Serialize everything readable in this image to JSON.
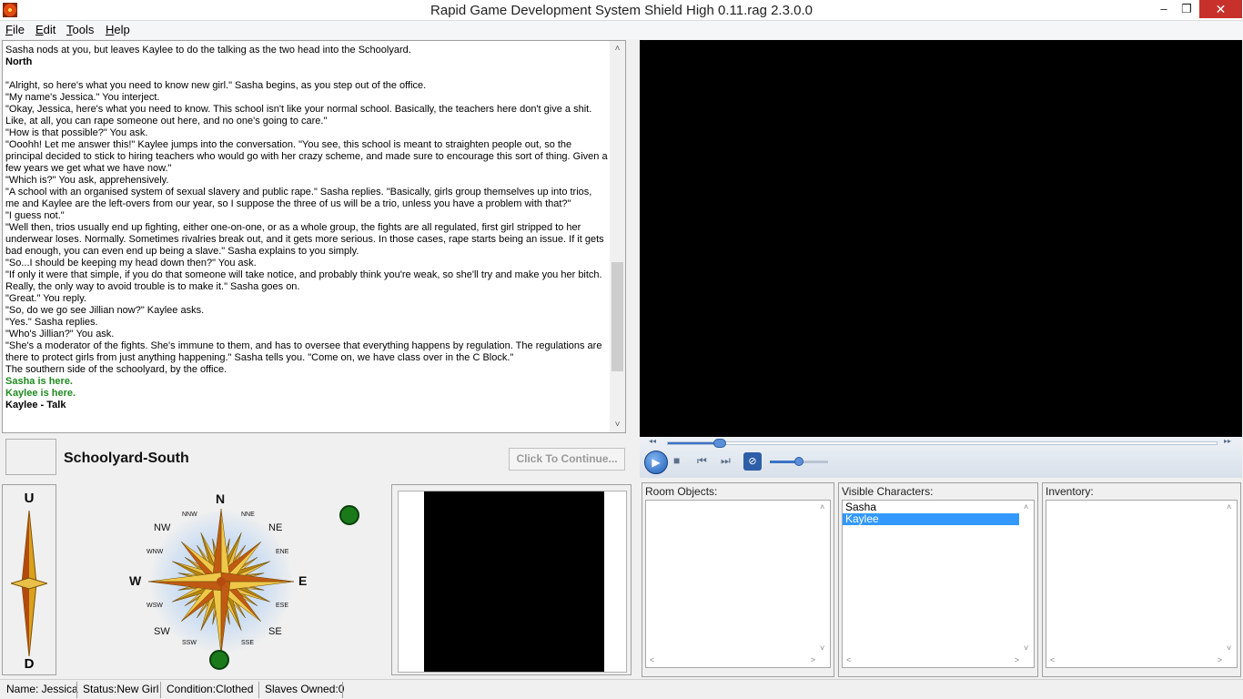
{
  "window": {
    "title": "Rapid Game Development System Shield High 0.11.rag 2.3.0.0",
    "min_glyph": "–",
    "max_glyph": "❐",
    "close_glyph": "✕"
  },
  "menu": [
    {
      "label": "File",
      "ul": "F",
      "rest": "ile"
    },
    {
      "label": "Edit",
      "ul": "E",
      "rest": "dit"
    },
    {
      "label": "Tools",
      "ul": "T",
      "rest": "ools"
    },
    {
      "label": "Help",
      "ul": "H",
      "rest": "elp"
    }
  ],
  "story": {
    "lines": [
      {
        "style": "normal",
        "text": "Sasha nods at you, but leaves Kaylee to do the talking as the two head into the Schoolyard."
      },
      {
        "style": "bold",
        "text": "North"
      },
      {
        "style": "normal",
        "text": " "
      },
      {
        "style": "normal",
        "text": "\"Alright, so here's what you need to know new girl.\" Sasha begins, as you step out of the office."
      },
      {
        "style": "normal",
        "text": "\"My name's Jessica.\" You interject."
      },
      {
        "style": "normal",
        "text": "\"Okay, Jessica, here's what you need to know. This school isn't like your normal school. Basically, the teachers here don't give a shit. Like, at all, you can rape someone out here, and no one's going to care.\""
      },
      {
        "style": "normal",
        "text": "\"How is that possible?\" You ask."
      },
      {
        "style": "normal",
        "text": "\"Ooohh! Let me answer this!\" Kaylee jumps into the conversation. \"You see, this school is meant to straighten people out, so the principal decided to stick to hiring teachers who would go with her crazy scheme, and made sure to encourage this sort of thing. Given a few years we get what we have now.\""
      },
      {
        "style": "normal",
        "text": "\"Which is?\" You ask, apprehensively."
      },
      {
        "style": "normal",
        "text": "\"A school with an organised system of sexual slavery and public rape.\" Sasha replies. \"Basically, girls group themselves up into trios, me and Kaylee are the left-overs from our year, so I suppose the three of us will be a trio, unless you have a problem with that?\""
      },
      {
        "style": "normal",
        "text": "\"I guess not.\""
      },
      {
        "style": "normal",
        "text": "\"Well then, trios usually end up fighting, either one-on-one, or as a whole group, the fights are all regulated, first girl stripped to her underwear loses. Normally. Sometimes rivalries break out, and it gets more serious. In those cases, rape starts being an issue. If it gets bad enough, you can even end up being a slave.\" Sasha explains to you simply."
      },
      {
        "style": "normal",
        "text": "\"So...I should be keeping my head down then?\" You ask."
      },
      {
        "style": "normal",
        "text": "\"If only it were that simple, if you do that someone will take notice, and probably think you're weak, so she'll try and make you her bitch. Really, the only way to avoid trouble is to make it.\" Sasha goes on."
      },
      {
        "style": "normal",
        "text": "\"Great.\" You reply."
      },
      {
        "style": "normal",
        "text": "\"So, do we go see Jillian now?\" Kaylee asks."
      },
      {
        "style": "normal",
        "text": "\"Yes.\" Sasha replies."
      },
      {
        "style": "normal",
        "text": "\"Who's Jillian?\" You ask."
      },
      {
        "style": "normal",
        "text": "\"She's a moderator of the fights. She's immune to them, and has to oversee that everything happens by regulation. The regulations are there to protect girls from just anything happening.\" Sasha tells you. \"Come on, we have class over in the C Block.\""
      },
      {
        "style": "normal",
        "text": "The southern side of the schoolyard, by the office."
      },
      {
        "style": "green",
        "text": "Sasha is here."
      },
      {
        "style": "green",
        "text": "Kaylee is here."
      },
      {
        "style": "bold",
        "text": "Kaylee - Talk"
      }
    ],
    "scroll_position": 0.82
  },
  "location": {
    "name": "Schoolyard-South",
    "continue_label": "Click To Continue..."
  },
  "media_player": {
    "seek_progress": 0.09,
    "volume": 0.5,
    "icons": [
      "play-icon",
      "stop-icon",
      "previous-icon",
      "next-icon",
      "mute-icon"
    ],
    "glyphs": {
      "play": "▶",
      "stop": "■",
      "prev": "⏮",
      "next": "⏭",
      "mute": "⊘",
      "rewind": "◂◂",
      "forward": "▸▸"
    }
  },
  "updown": {
    "up": "U",
    "down": "D"
  },
  "compass": {
    "N": "N",
    "S": "S",
    "E": "E",
    "W": "W",
    "NE": "NE",
    "NW": "NW",
    "SE": "SE",
    "SW": "SW",
    "NNE": "NNE",
    "NNW": "NNW",
    "ENE": "ENE",
    "ESE": "ESE",
    "SSE": "SSE",
    "SSW": "SSW",
    "WNW": "WNW",
    "WSW": "WSW"
  },
  "room_objects": {
    "label": "Room Objects:",
    "items": []
  },
  "visible_characters": {
    "label": "Visible Characters:",
    "items": [
      "Sasha",
      "Kaylee"
    ],
    "selected": "Kaylee"
  },
  "inventory": {
    "label": "Inventory:",
    "items": []
  },
  "scroll_glyphs": {
    "up": "˄",
    "down": "˅",
    "left": "˂",
    "right": "˃"
  },
  "status": {
    "name": "Name: Jessica",
    "status": "Status:New Girl",
    "condition": "Condition:Clothed",
    "slaves": "Slaves Owned:0"
  },
  "colors": {
    "accent": "#3399ff",
    "present_text": "#1f8a1f",
    "compass_dot": "#1a7a1a"
  }
}
